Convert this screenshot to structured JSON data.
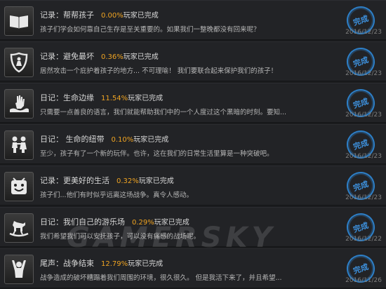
{
  "watermark": "GAMERSKY",
  "colors": {
    "percent": "#f0a422",
    "stamp": "#2d7fc7",
    "row_bg": "#222326"
  },
  "achievements": [
    {
      "icon": "open-book-icon",
      "title": "记录：帮帮孩子",
      "percent": "0.00%",
      "percent_label": "玩家已完成",
      "description": "孩子们学会如何靠自己生存是至关重要的。如果我们一整晚都没有回来呢？",
      "stamp": "完成",
      "date": "2016/12/23"
    },
    {
      "icon": "shield-figure-icon",
      "title": "记录：避免最坏",
      "percent": "0.36%",
      "percent_label": "玩家已完成",
      "description": "居然攻击一个庇护着孩子的地方... 不可理喻！ 我们要联合起来保护我们的孩子！",
      "stamp": "完成",
      "date": "2016/12/23"
    },
    {
      "icon": "drowning-hand-icon",
      "title": "日记：生命边缘",
      "percent": "11.54%",
      "percent_label": "玩家已完成",
      "description": "只需要一点善良的语言，我们就能帮助我们中的一个人度过这个黑暗的时刻。要知...",
      "stamp": "完成",
      "date": "2016/12/23"
    },
    {
      "icon": "two-children-icon",
      "title": "日记： 生命的纽带",
      "percent": "0.10%",
      "percent_label": "玩家已完成",
      "description": "至少，孩子有了一个新的玩伴。也许，这在我们的日常生活里算是一种突破吧。",
      "stamp": "完成",
      "date": "2016/12/23"
    },
    {
      "icon": "happy-face-icon",
      "title": "记录：更美好的生活",
      "percent": "0.32%",
      "percent_label": "玩家已完成",
      "description": "孩子们...他们有时似乎远离这场战争。真令人感动。",
      "stamp": "完成",
      "date": "2016/12/23"
    },
    {
      "icon": "rocking-horse-icon",
      "title": "日记：我们自己的游乐场",
      "percent": "0.29%",
      "percent_label": "玩家已完成",
      "description": "我们希望我们可以安抚孩子，可以没有痛感的战场呢。",
      "stamp": "完成",
      "date": "2016/12/22"
    },
    {
      "icon": "raised-arms-icon",
      "title": "尾声：战争结束",
      "percent": "12.79%",
      "percent_label": "玩家已完成",
      "description": "战争造成的破坏糟蹋着我们周围的环境，很久很久。 但是我活下来了，并且希望...",
      "stamp": "完成",
      "date": "2016/11/26"
    }
  ]
}
